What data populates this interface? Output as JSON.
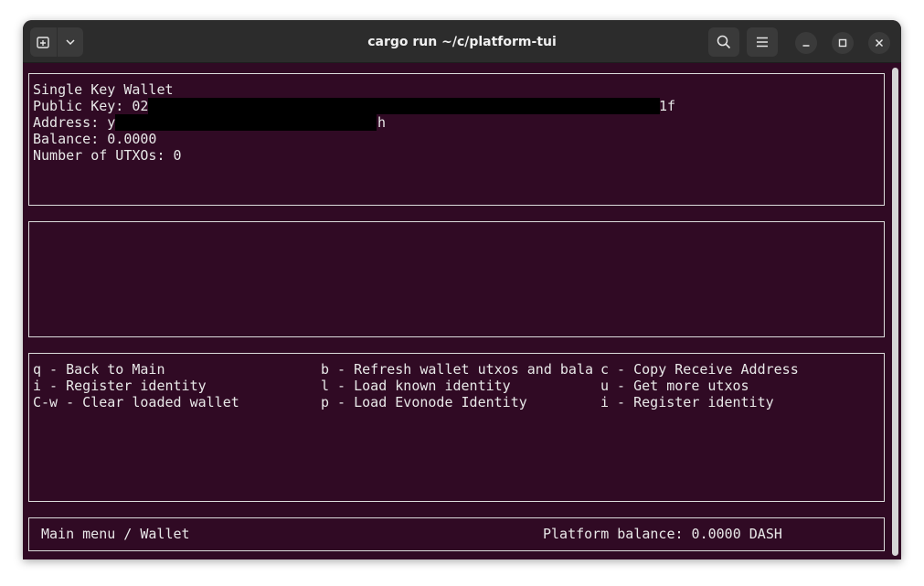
{
  "window": {
    "title": "cargo run ~/c/platform-tui",
    "background": "#300a24"
  },
  "wallet": {
    "heading": "Single Key Wallet",
    "public_key_label": "Public Key: 02",
    "public_key_tail": "1f",
    "address_label": "Address: y",
    "address_tail": "h",
    "balance": "Balance: 0.0000",
    "utxos": "Number of UTXOs: 0"
  },
  "keys": {
    "col1": [
      "q - Back to Main",
      "i - Register identity",
      "C-w - Clear loaded wallet"
    ],
    "col2": [
      "b - Refresh wallet utxos and bala",
      "l - Load known identity",
      "p - Load Evonode Identity"
    ],
    "col3": [
      "c - Copy Receive Address",
      "u - Get more utxos",
      "i - Register identity"
    ]
  },
  "status": {
    "breadcrumb": "Main menu / Wallet",
    "platform_balance": "Platform balance: 0.0000 DASH"
  }
}
